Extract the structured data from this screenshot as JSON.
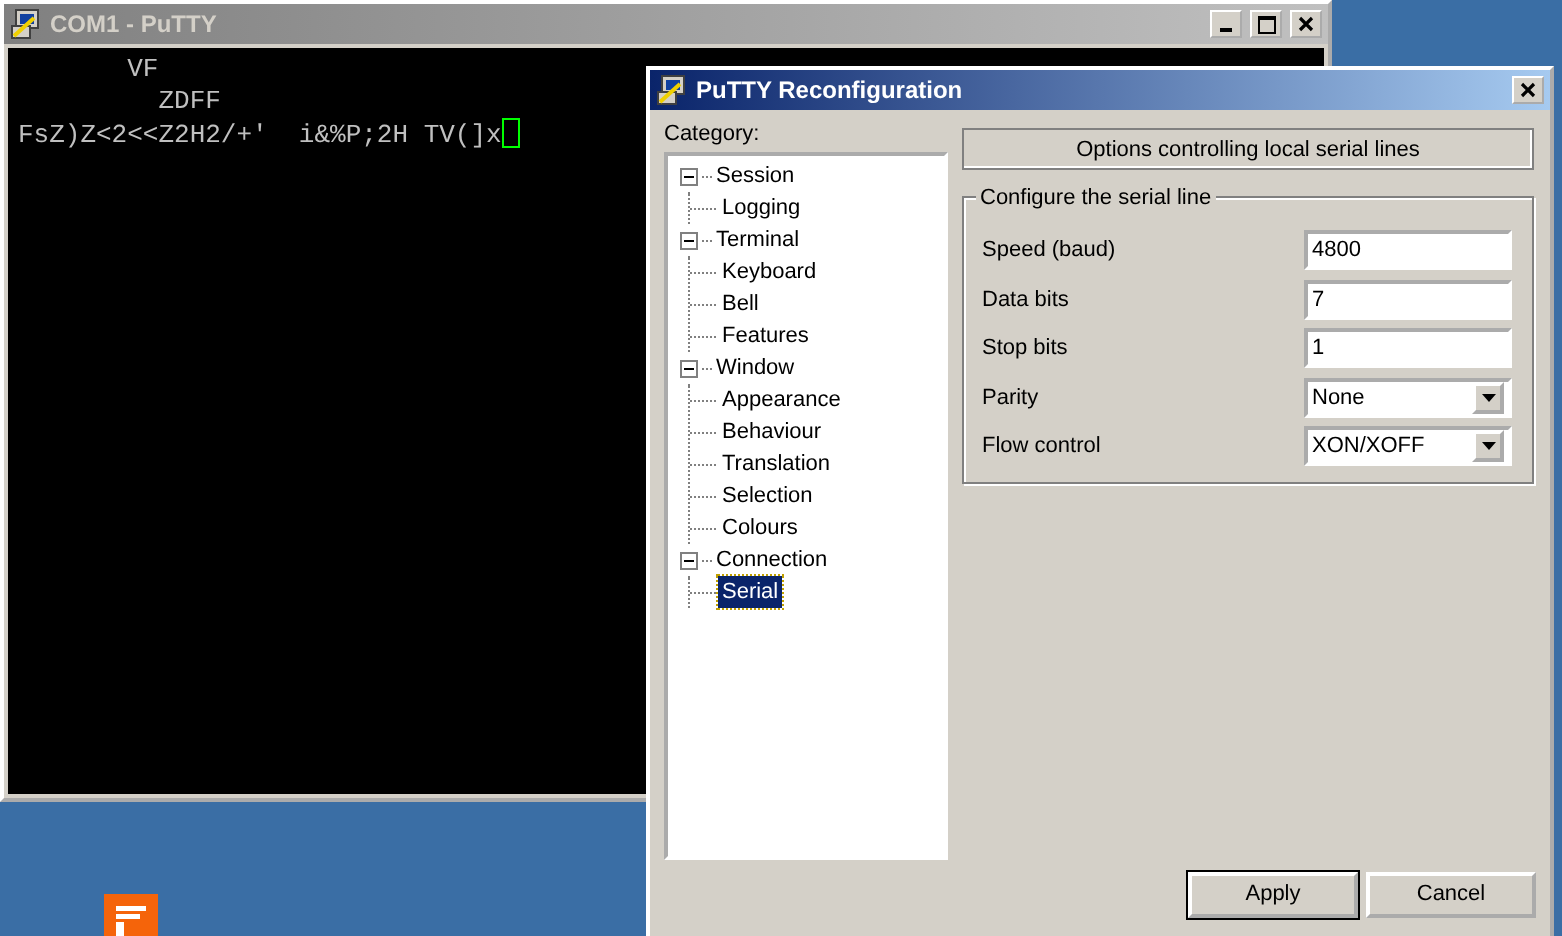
{
  "terminal_window": {
    "title": "COM1 - PuTTY",
    "lines": [
      "       VF",
      "         ZDFF",
      "FsZ)Z<2<<Z2H2/+'  i&%P;2H TV(]x"
    ]
  },
  "dialog": {
    "title": "PuTTY Reconfiguration",
    "category_label": "Category:",
    "tree": [
      {
        "label": "Session",
        "expanded": true,
        "selected": false,
        "children": [
          {
            "label": "Logging",
            "selected": false
          }
        ]
      },
      {
        "label": "Terminal",
        "expanded": true,
        "selected": false,
        "children": [
          {
            "label": "Keyboard",
            "selected": false
          },
          {
            "label": "Bell",
            "selected": false
          },
          {
            "label": "Features",
            "selected": false
          }
        ]
      },
      {
        "label": "Window",
        "expanded": true,
        "selected": false,
        "children": [
          {
            "label": "Appearance",
            "selected": false
          },
          {
            "label": "Behaviour",
            "selected": false
          },
          {
            "label": "Translation",
            "selected": false
          },
          {
            "label": "Selection",
            "selected": false
          },
          {
            "label": "Colours",
            "selected": false
          }
        ]
      },
      {
        "label": "Connection",
        "expanded": true,
        "selected": false,
        "children": [
          {
            "label": "Serial",
            "selected": true
          }
        ]
      }
    ],
    "panel_header": "Options controlling local serial lines",
    "group": {
      "legend": "Configure the serial line",
      "fields": [
        {
          "label": "Speed (baud)",
          "kind": "text",
          "value": "4800"
        },
        {
          "label": "Data bits",
          "kind": "text",
          "value": "7"
        },
        {
          "label": "Stop bits",
          "kind": "text",
          "value": "1"
        },
        {
          "label": "Parity",
          "kind": "dropdown",
          "value": "None"
        },
        {
          "label": "Flow control",
          "kind": "dropdown",
          "value": "XON/XOFF"
        }
      ]
    },
    "buttons": [
      "Apply",
      "Cancel"
    ]
  }
}
